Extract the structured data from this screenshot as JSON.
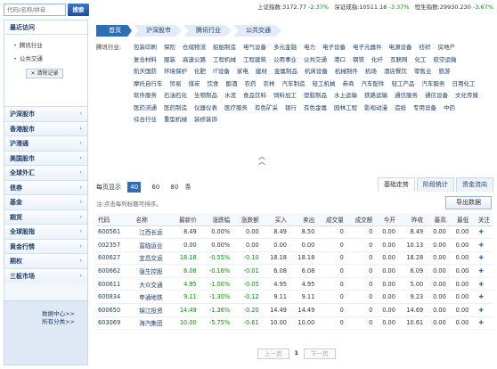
{
  "search": {
    "placeholder": "代码/名称/拼音",
    "button": "搜索"
  },
  "quotes": [
    {
      "name": "上证指数:",
      "value": "3172.77",
      "change": "-2.37%",
      "dir": "down"
    },
    {
      "name": "深证成指:",
      "value": "10511.16",
      "change": "-3.37%",
      "dir": "down"
    },
    {
      "name": "恒生指数:",
      "value": "29930.230",
      "change": "-3.67%",
      "dir": "down"
    }
  ],
  "sidebar": {
    "recent_title": "最近访问",
    "recent_items": [
      "腾讯行业",
      "公共交通"
    ],
    "clear_label": "清除记录",
    "items": [
      "沪深股市",
      "香港股市",
      "沪港通",
      "美国股市",
      "全球外汇",
      "债券",
      "基金",
      "期货",
      "全球股指",
      "黄金行情",
      "期权",
      "三板市场"
    ],
    "footer": [
      "数据中心>>",
      "所有分类>>"
    ]
  },
  "breadcrumb": [
    "首页",
    "沪深股市",
    "腾讯行业",
    "公共交通"
  ],
  "industry": {
    "label": "腾讯行业:",
    "items": [
      "包装印刷",
      "保险",
      "仓储物流",
      "船舶制造",
      "电气设备",
      "多元金融",
      "电力",
      "电子设备",
      "电子元器件",
      "电源设备",
      "纺织",
      "房地产",
      "复合材料",
      "服装",
      "高速公路",
      "工程机械",
      "工程建筑",
      "公用事业",
      "公共交通",
      "港口",
      "钢铁",
      "化纤",
      "互联网",
      "化工",
      "航空运输",
      "航天国防",
      "环境保护",
      "化肥",
      "IT设备",
      "家电",
      "建材",
      "金属制品",
      "机床设备",
      "机械制件",
      "机场",
      "酒店餐饮",
      "零售业",
      "旅游",
      "摩托自行车",
      "贸易",
      "煤炭",
      "饮食",
      "酿酒",
      "农药",
      "农林",
      "汽车制造",
      "轻工机械",
      "券商",
      "汽车配件",
      "轻工产品",
      "汽车服务",
      "日用化工",
      "软件服务",
      "石油石化",
      "生物制品",
      "水泥",
      "食品饮料",
      "饲料加工",
      "塑胶制品",
      "水上运输",
      "铁路运输",
      "通信服务",
      "通信设备",
      "文化传媒",
      "医药流通",
      "医药制造",
      "仪器仪表",
      "医疗服务",
      "有色矿采",
      "银行",
      "有色金属",
      "园林工程",
      "影视动漫",
      "造纸",
      "专用设备",
      "中药",
      "综合行业",
      "重型机械",
      "装修装饰"
    ]
  },
  "pager": {
    "label": "每页显示",
    "sizes": [
      "40",
      "60",
      "80"
    ],
    "unit": "条",
    "active": "40"
  },
  "tabs": [
    "基础走势",
    "阶段统计",
    "资金流向"
  ],
  "notice": "注:点击每列标题可排序。",
  "export_label": "导出数据",
  "table": {
    "headers": [
      "代码",
      "名称",
      "最新价",
      "涨跌幅",
      "涨跌额",
      "买入",
      "卖出",
      "成交量",
      "成交额",
      "今开",
      "昨收",
      "最高",
      "最低",
      "关注"
    ],
    "rows": [
      [
        "600561",
        "江西长运",
        "8.49",
        "0.00%",
        "0.00",
        "8.49",
        "8.50",
        "0",
        "0",
        "0.00",
        "8.49",
        "0.00",
        "0.00"
      ],
      [
        "002357",
        "富临运业",
        "0.00",
        "0.00%",
        "0.00",
        "0.00",
        "0.00",
        "0",
        "0",
        "0.00",
        "10.13",
        "0.00",
        "0.00"
      ],
      [
        "600627",
        "宜昌交运",
        "18.18",
        "-0.55%",
        "-0.10",
        "18.18",
        "18.18",
        "0",
        "0",
        "0.00",
        "18.28",
        "0.00",
        "0.00"
      ],
      [
        "600662",
        "强生控股",
        "6.08",
        "-0.16%",
        "-0.01",
        "6.08",
        "6.08",
        "0",
        "0",
        "0.00",
        "6.09",
        "0.00",
        "0.00"
      ],
      [
        "600611",
        "大众交通",
        "4.95",
        "-1.00%",
        "-0.05",
        "4.95",
        "4.95",
        "0",
        "0",
        "0.00",
        "5.00",
        "0.00",
        "0.00"
      ],
      [
        "600834",
        "申通地铁",
        "9.11",
        "-1.30%",
        "-0.12",
        "9.11",
        "9.11",
        "0",
        "0",
        "0.00",
        "9.23",
        "0.00",
        "0.00"
      ],
      [
        "600650",
        "锦江投资",
        "14.49",
        "-1.36%",
        "-0.20",
        "14.49",
        "14.49",
        "0",
        "0",
        "0.00",
        "14.69",
        "0.00",
        "0.00"
      ],
      [
        "603069",
        "海汽集团",
        "10.00",
        "-5.75%",
        "-0.61",
        "10.00",
        "10.00",
        "0",
        "0",
        "0.00",
        "10.61",
        "0.00",
        "0.00"
      ]
    ],
    "colors": [
      "",
      "",
      "up",
      "",
      "down",
      "down",
      "down",
      "down",
      "down",
      "down",
      "down"
    ]
  },
  "bottom_pager": {
    "prev": "上一页",
    "page": "1",
    "next": "下一页"
  },
  "colors": {
    "accent": "#2f6db5",
    "up": "#e00000",
    "down": "#009900"
  }
}
